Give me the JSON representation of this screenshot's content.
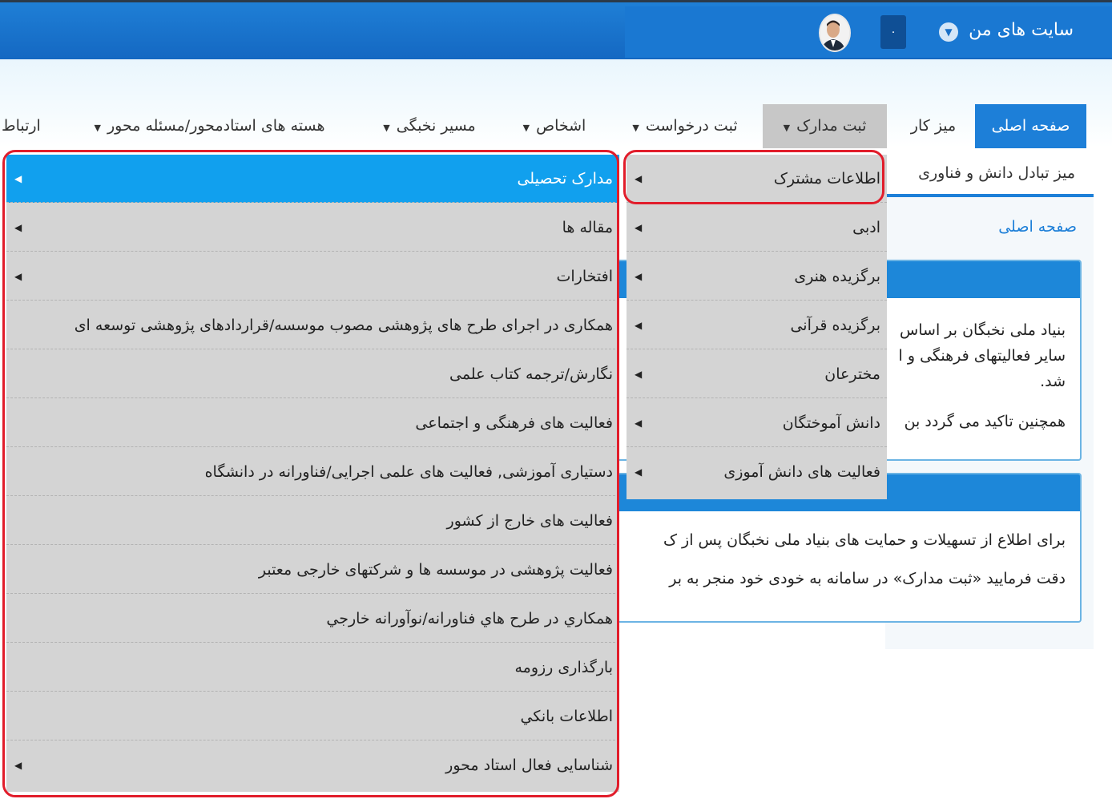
{
  "header": {
    "site_title": "سایت های من",
    "notif_count": "۰"
  },
  "nav": {
    "home": "صفحه اصلی",
    "desk": "میز کار",
    "docs": "ثبت مدارک",
    "request": "ثبت درخواست",
    "persons": "اشخاص",
    "elite_path": "مسیر نخبگی",
    "cores": "هسته های استادمحور/مسئله محور",
    "contact": "ارتباط"
  },
  "subtab": "میز تبادل دانش و فناوری",
  "breadcrumb": "صفحه اصلی",
  "panel1": {
    "line1": "بنیاد ملی نخبگان بر اساس",
    "line2": "سایر فعالیتهای فرهنگی و ا",
    "line3": "شد.",
    "line4": "همچنین تاکید می گردد بن"
  },
  "panel2": {
    "line1": "برای اطلاع از تسهیلات و حمایت های بنیاد ملی نخبگان پس از ک",
    "line2": "دقت فرمایید «ثبت مدارک» در سامانه به خودی خود منجر به بر"
  },
  "menu_level1": [
    {
      "label": "اطلاعات مشترک",
      "arrow": "◀"
    },
    {
      "label": "ادبی",
      "arrow": "◀"
    },
    {
      "label": "برگزیده هنری",
      "arrow": "◀"
    },
    {
      "label": "برگزیده قرآنی",
      "arrow": "◀"
    },
    {
      "label": "مخترعان",
      "arrow": "◀"
    },
    {
      "label": "دانش آموختگان",
      "arrow": "◀"
    },
    {
      "label": "فعالیت های دانش آموزی",
      "arrow": "◀"
    }
  ],
  "menu_level2": [
    {
      "label": "مدارک تحصیلی",
      "arrow": "◀"
    },
    {
      "label": "مقاله ها",
      "arrow": "◀"
    },
    {
      "label": "افتخارات",
      "arrow": "◀"
    },
    {
      "label": "همکاری در اجرای طرح های پژوهشی مصوب موسسه/قراردادهای پژوهشی توسعه ای",
      "arrow": ""
    },
    {
      "label": "نگارش/ترجمه کتاب علمی",
      "arrow": ""
    },
    {
      "label": "فعالیت های فرهنگی و اجتماعی",
      "arrow": ""
    },
    {
      "label": "دستیاری آموزشی, فعالیت های علمی اجرایی/فناورانه در دانشگاه",
      "arrow": ""
    },
    {
      "label": "فعالیت های خارج از کشور",
      "arrow": ""
    },
    {
      "label": "فعالیت پژوهشی در موسسه ها و شرکتهای خارجی معتبر",
      "arrow": ""
    },
    {
      "label": "همكاري در طرح هاي فناورانه/نوآورانه خارجي",
      "arrow": ""
    },
    {
      "label": "بارگذاری رزومه",
      "arrow": ""
    },
    {
      "label": "اطلاعات بانكي",
      "arrow": ""
    },
    {
      "label": "شناسایی فعال استاد محور",
      "arrow": "◀"
    }
  ],
  "colors": {
    "primary": "#1d7fd8",
    "selected": "#11a0ee",
    "annotation": "#e11d2b",
    "menu_bg": "#d4d4d4"
  }
}
